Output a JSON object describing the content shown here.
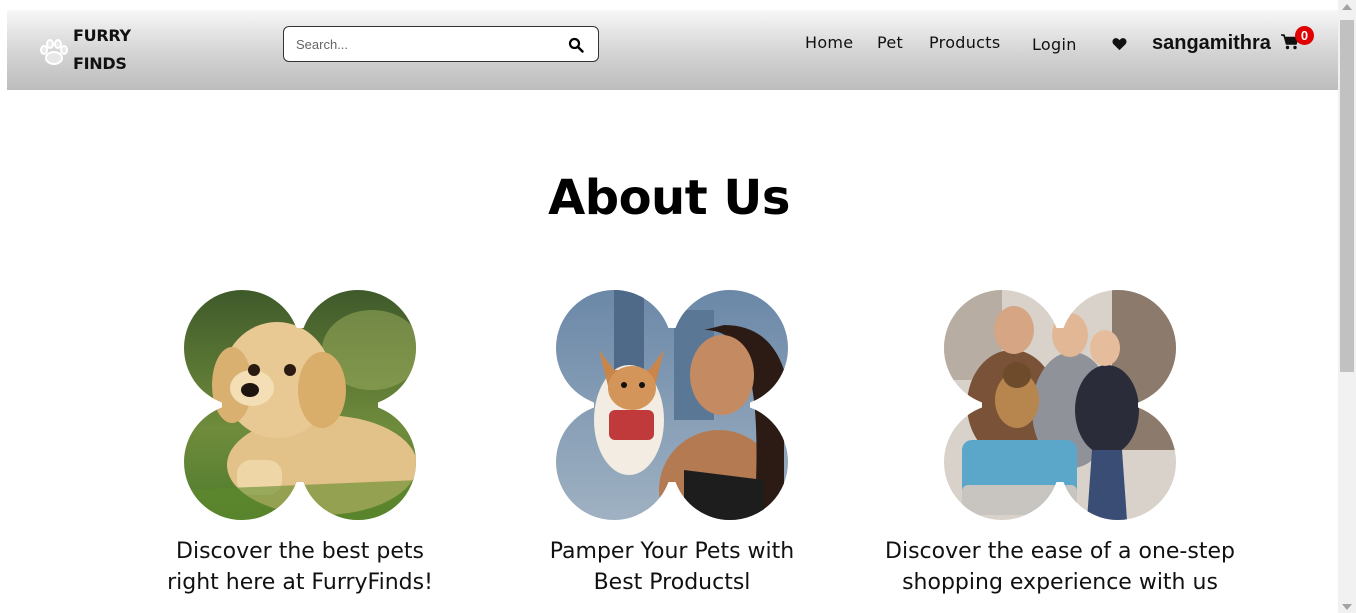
{
  "brand": {
    "line1": "FURRY",
    "line2": "FINDS",
    "icon": "paw-icon"
  },
  "search": {
    "placeholder": "Search...",
    "value": "",
    "icon": "search-icon"
  },
  "nav": {
    "home": "Home",
    "pet": "Pet",
    "products": "Products",
    "login": "Login",
    "wishlist_icon": "heart-icon",
    "username": "sangamithra",
    "cart_icon": "cart-icon",
    "cart_count": "0"
  },
  "about": {
    "title": "About Us",
    "features": [
      {
        "line1": "Discover the best pets",
        "line2": "right here at FurryFinds!"
      },
      {
        "line1": "Pamper Your Pets with",
        "line2": "Best Productsl"
      },
      {
        "line1": "Discover the ease of a one-step",
        "line2": "shopping experience with us"
      }
    ]
  },
  "colors": {
    "accent_badge": "#e00000",
    "navbar_top": "#f7f7f7",
    "navbar_bottom": "#bdbdbd"
  }
}
